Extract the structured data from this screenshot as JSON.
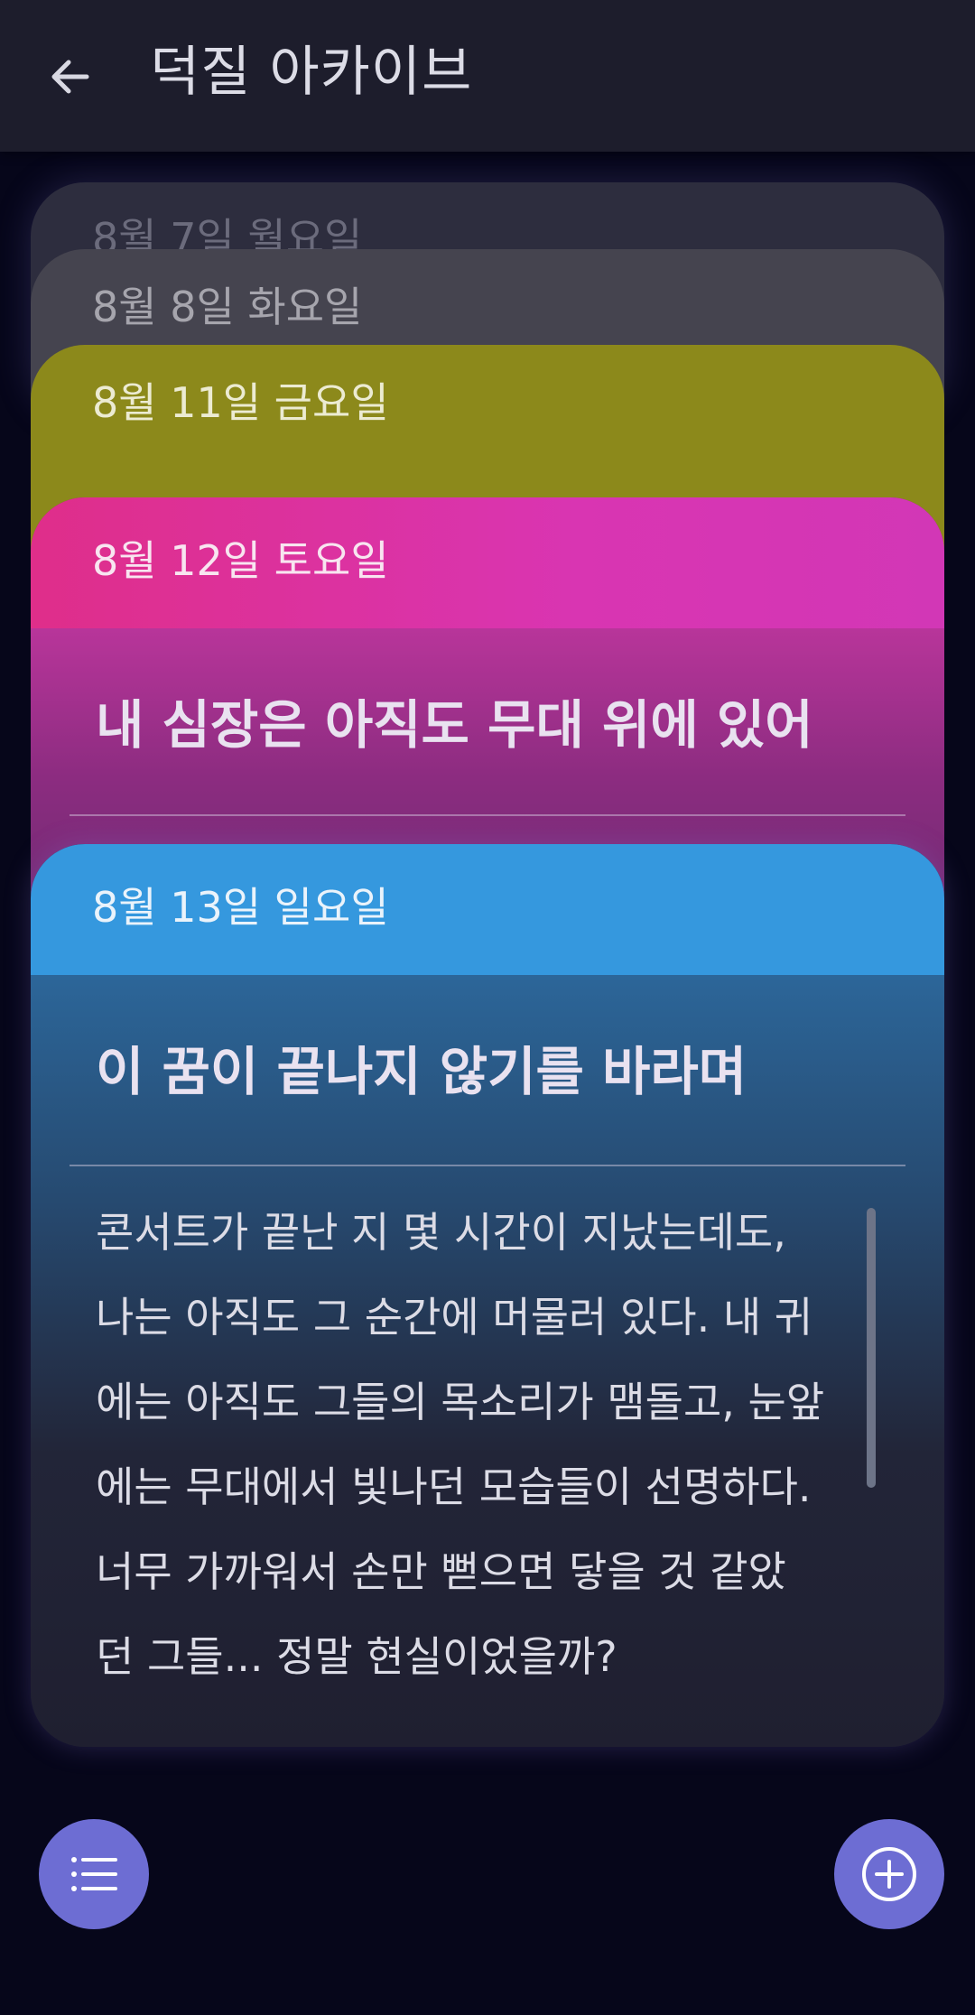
{
  "header": {
    "title": "덕질 아카이브",
    "back_icon": "arrow-left-icon"
  },
  "cards": [
    {
      "date": "8월 7일 월요일",
      "color": "#2d2d3e"
    },
    {
      "date": "8월 8일 화요일",
      "color": "#45444f"
    },
    {
      "date": "8월 11일 금요일",
      "color": "#8c891b"
    },
    {
      "date": "8월 12일 토요일",
      "color": "#d935b2",
      "title": "내 심장은 아직도 무대 위에 있어"
    },
    {
      "date": "8월 13일 일요일",
      "color": "#3598de",
      "title": "이 꿈이 끝나지 않기를 바라며",
      "content_lines": [
        "콘서트가 끝난 지 몇 시간이 지났는데도,",
        "나는 아직도 그 순간에 머물러 있다. 내 귀",
        "에는 아직도 그들의 목소리가 맴돌고, 눈앞",
        "에는 무대에서 빛나던 모습들이 선명하다.",
        "너무 가까워서 손만 뻗으면 닿을 것 같았",
        "던 그들... 정말 현실이었을까?"
      ]
    }
  ],
  "fabs": {
    "list_icon": "list-icon",
    "add_icon": "add-circle-icon",
    "color": "#6d6dd3"
  }
}
